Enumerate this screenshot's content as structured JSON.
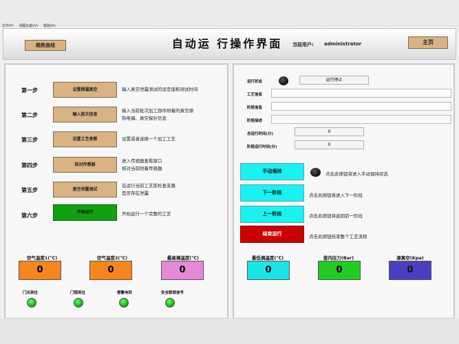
{
  "menu": [
    "文件(F)",
    "视图功能(V)",
    "帮助(H)"
  ],
  "header": {
    "trend_button": "趋势曲线",
    "title": "自动运 行操作界面",
    "user_label": "当前用户:",
    "user_name": "administrator",
    "home_button": "主页"
  },
  "steps": [
    {
      "step": "第一步",
      "button": "设置倒漏真空",
      "desc1": "输入真空泄露测试的设定值和测试时间",
      "desc2": ""
    },
    {
      "step": "第二步",
      "button": "输入批次信息",
      "desc1": "输入当前批次加工部件附着的真空源",
      "desc2": "热电偶、真空探针信息"
    },
    {
      "step": "第三步",
      "button": "设置工艺参数",
      "desc1": "设置或者选择一个加工工艺",
      "desc2": ""
    },
    {
      "step": "第四步",
      "button": "核对传感器",
      "desc1": "进入传感器查看窗口",
      "desc2": "核对当前附着传感器"
    },
    {
      "step": "第五步",
      "button": "真空泄露测试",
      "desc1": "在运行当前工艺前检查支路",
      "desc2": "是否存在泄露"
    },
    {
      "step": "第六步",
      "button": "开始运行",
      "desc1": "开始运行一个完整的工艺",
      "desc2": ""
    }
  ],
  "left_meters": [
    {
      "label": "空气温度1(℃)",
      "value": "0",
      "color": "#f5861e"
    },
    {
      "label": "空气温度2(℃)",
      "value": "0",
      "color": "#f5861e"
    },
    {
      "label": "最高偶温度(℃)",
      "value": "0",
      "color": "#e589d6"
    }
  ],
  "lamps": [
    {
      "label": "门关到位"
    },
    {
      "label": "门锁到位"
    },
    {
      "label": "报警电铃"
    },
    {
      "label": "安全联锁信号"
    }
  ],
  "right": {
    "run_state_label": "运行状态",
    "run_state_button": "运行停止",
    "process_label": "工艺信息",
    "stage_info_label": "阶段信息",
    "stage_desc_label": "阶段描述",
    "total_time_label": "总运行时间(分)",
    "total_time_value": "0",
    "stage_time_label": "阶段运行时间(分)",
    "stage_time_value": "0"
  },
  "controls": [
    {
      "button": "手动保持",
      "desc": "点击此按钮将进入手动保持状态"
    },
    {
      "button": "下一阶段",
      "desc": "点击此按钮将进入下一阶段"
    },
    {
      "button": "上一阶段",
      "desc": "点击此按钮将返回前一阶段"
    },
    {
      "button": "结束运行",
      "desc": "点击此按钮结束整个工艺流程"
    }
  ],
  "right_meters": [
    {
      "label": "最低偶温度(℃)",
      "value": "0",
      "color": "#19e6e6"
    },
    {
      "label": "釜内压力(Bar)",
      "value": "0",
      "color": "#22cc22"
    },
    {
      "label": "源真空(Kpa)",
      "value": "0",
      "color": "#4a3fc0"
    }
  ]
}
